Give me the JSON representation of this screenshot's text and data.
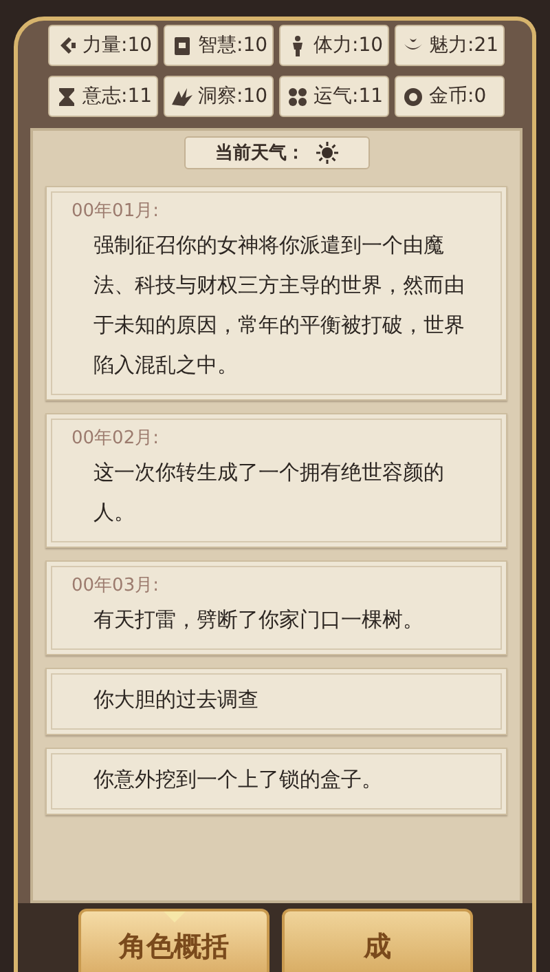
{
  "stats": [
    {
      "text": "力量:10"
    },
    {
      "text": "智慧:10"
    },
    {
      "text": "体力:10"
    },
    {
      "text": "魅力:21"
    },
    {
      "text": "意志:11"
    },
    {
      "text": "洞察:10"
    },
    {
      "text": "运气:11"
    },
    {
      "text": "金币:0"
    }
  ],
  "weather": {
    "label": "当前天气："
  },
  "log": [
    {
      "date": "00年01月:",
      "text": "强制征召你的女神将你派遣到一个由魔法、科技与财权三方主导的世界，然而由于未知的原因，常年的平衡被打破，世界陷入混乱之中。"
    },
    {
      "date": "00年02月:",
      "text": "这一次你转生成了一个拥有绝世容颜的人。"
    },
    {
      "date": "00年03月:",
      "text": "有天打雷，劈断了你家门口一棵树。"
    },
    {
      "text": "你大胆的过去调查"
    },
    {
      "text": "你意外挖到一个上了锁的盒子。"
    }
  ],
  "tabs": [
    {
      "label": "角色概括",
      "selected": true
    },
    {
      "label": "成",
      "selected": false
    }
  ]
}
